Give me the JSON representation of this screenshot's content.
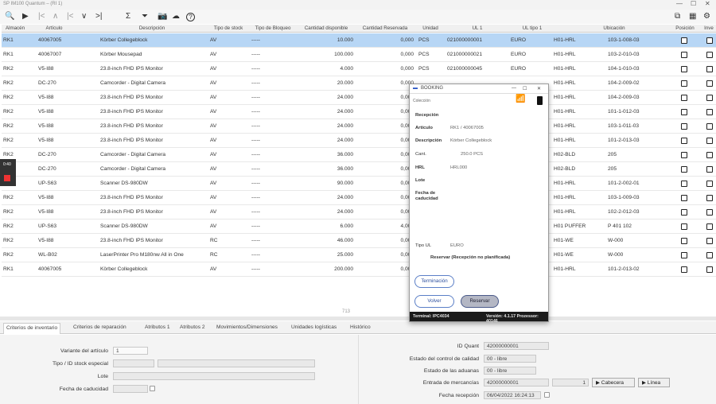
{
  "window": {
    "title": "SP IM100 Quantum – (RI 1)"
  },
  "toolbar": {
    "search": "🔍",
    "play": "▶",
    "first": "|<",
    "up": "∧",
    "prev": "|<",
    "down": "∨",
    "last": ">|",
    "sum": "Σ",
    "filter": "⏷",
    "camera": "📷",
    "cloud": "☁",
    "help": "?"
  },
  "grid": {
    "columns": [
      "Almacén",
      "Artículo",
      "Descripción",
      "Tipo de stock",
      "Tipo de Bloqueo",
      "Cantidad disponible",
      "Cantidad Reservada",
      "Unidad",
      "UL 1",
      "UL tipo 1",
      "Ubicación",
      "Posición",
      "Inve"
    ],
    "rows": [
      {
        "alm": "RK1",
        "art": "40067005",
        "desc": "Körber Collegeblock",
        "tipo": "AV",
        "bloq": "-----",
        "disp": "10.000",
        "res": "0,000",
        "uni": "PCS",
        "ul": "021000000001",
        "ult": "EURO",
        "ubic": "H01-HRL",
        "pos": "103-1-008-03"
      },
      {
        "alm": "RK1",
        "art": "40067007",
        "desc": "Körber Mousepad",
        "tipo": "AV",
        "bloq": "-----",
        "disp": "100.000",
        "res": "0,000",
        "uni": "PCS",
        "ul": "021000000021",
        "ult": "EURO",
        "ubic": "H01-HRL",
        "pos": "103-2-010-03"
      },
      {
        "alm": "RK2",
        "art": "V5-I88",
        "desc": "23.8-inch FHD IPS Monitor",
        "tipo": "AV",
        "bloq": "-----",
        "disp": "4.000",
        "res": "0,000",
        "uni": "PCS",
        "ul": "021000000045",
        "ult": "EURO",
        "ubic": "H01-HRL",
        "pos": "104-1-010-03"
      },
      {
        "alm": "RK2",
        "art": "DC-270",
        "desc": "Camcorder - Digital Camera",
        "tipo": "AV",
        "bloq": "-----",
        "disp": "20.000",
        "res": "0,000",
        "uni": "",
        "ul": "",
        "ult": "",
        "ubic": "H01-HRL",
        "pos": "104-2-009-02"
      },
      {
        "alm": "RK2",
        "art": "V5-I88",
        "desc": "23.8-inch FHD IPS Monitor",
        "tipo": "AV",
        "bloq": "-----",
        "disp": "24.000",
        "res": "0,000",
        "uni": "",
        "ul": "",
        "ult": "",
        "ubic": "H01-HRL",
        "pos": "104-2-009-03"
      },
      {
        "alm": "RK2",
        "art": "V5-I88",
        "desc": "23.8-inch FHD IPS Monitor",
        "tipo": "AV",
        "bloq": "-----",
        "disp": "24.000",
        "res": "0,000",
        "uni": "",
        "ul": "",
        "ult": "",
        "ubic": "H01-HRL",
        "pos": "101-1-012-03"
      },
      {
        "alm": "RK2",
        "art": "V5-I88",
        "desc": "23.8-inch FHD IPS Monitor",
        "tipo": "AV",
        "bloq": "-----",
        "disp": "24.000",
        "res": "0,000",
        "uni": "",
        "ul": "",
        "ult": "",
        "ubic": "H01-HRL",
        "pos": "103-1-011-03"
      },
      {
        "alm": "RK2",
        "art": "V5-I88",
        "desc": "23.8-inch FHD IPS Monitor",
        "tipo": "AV",
        "bloq": "-----",
        "disp": "24.000",
        "res": "0,000",
        "uni": "",
        "ul": "",
        "ult": "",
        "ubic": "H01-HRL",
        "pos": "101-2-013-03"
      },
      {
        "alm": "RK2",
        "art": "DC-270",
        "desc": "Camcorder - Digital Camera",
        "tipo": "AV",
        "bloq": "-----",
        "disp": "36.000",
        "res": "0,000",
        "uni": "",
        "ul": "",
        "ult": "",
        "ubic": "H02-BLD",
        "pos": "205"
      },
      {
        "alm": "RK2",
        "art": "DC-270",
        "desc": "Camcorder - Digital Camera",
        "tipo": "AV",
        "bloq": "-----",
        "disp": "36.000",
        "res": "0,000",
        "uni": "",
        "ul": "",
        "ult": "",
        "ubic": "H02-BLD",
        "pos": "205"
      },
      {
        "alm": "RK2",
        "art": "UP-S63",
        "desc": "Scanner DS-980DW",
        "tipo": "AV",
        "bloq": "-----",
        "disp": "90.000",
        "res": "0,000",
        "uni": "",
        "ul": "",
        "ult": "",
        "ubic": "H01-HRL",
        "pos": "101-2-002-01"
      },
      {
        "alm": "RK2",
        "art": "V5-I88",
        "desc": "23.8-inch FHD IPS Monitor",
        "tipo": "AV",
        "bloq": "-----",
        "disp": "24.000",
        "res": "0,000",
        "uni": "",
        "ul": "",
        "ult": "",
        "ubic": "H01-HRL",
        "pos": "103-1-009-03"
      },
      {
        "alm": "RK2",
        "art": "V5-I88",
        "desc": "23.8-inch FHD IPS Monitor",
        "tipo": "AV",
        "bloq": "-----",
        "disp": "24.000",
        "res": "0,000",
        "uni": "",
        "ul": "",
        "ult": "",
        "ubic": "H01-HRL",
        "pos": "102-2-012-03"
      },
      {
        "alm": "RK2",
        "art": "UP-S63",
        "desc": "Scanner DS-980DW",
        "tipo": "AV",
        "bloq": "-----",
        "disp": "6.000",
        "res": "4,000",
        "uni": "",
        "ul": "",
        "ult": "",
        "ubic": "H01 PUFFER",
        "pos": "P 401 102"
      },
      {
        "alm": "RK2",
        "art": "V5-I88",
        "desc": "23.8-inch FHD IPS Monitor",
        "tipo": "RC",
        "bloq": "-----",
        "disp": "46.000",
        "res": "0,000",
        "uni": "",
        "ul": "",
        "ult": "",
        "ubic": "H01-WE",
        "pos": "W-000"
      },
      {
        "alm": "RK2",
        "art": "WL-B02",
        "desc": "LaserPrinter Pro M180nw All in One",
        "tipo": "RC",
        "bloq": "-----",
        "disp": "25.000",
        "res": "0,000",
        "uni": "",
        "ul": "",
        "ult": "",
        "ubic": "H01-WE",
        "pos": "W-000"
      },
      {
        "alm": "RK1",
        "art": "40067005",
        "desc": "Körber Collegeblock",
        "tipo": "AV",
        "bloq": "-----",
        "disp": "200.000",
        "res": "0,000",
        "uni": "",
        "ul": "",
        "ult": "",
        "ubic": "H01-HRL",
        "pos": "101-2-013-02"
      }
    ],
    "count": "713"
  },
  "tabs": [
    "Criterios de inventario",
    "Criterios de reparación",
    "Atributos 1",
    "Atributos 2",
    "Movimientos/Dimensiones",
    "Unidades logísticas",
    "Histórico"
  ],
  "form": {
    "variante_label": "Variante del artículo",
    "variante_value": "1",
    "tipo_label": "Tipo / ID stock especial",
    "lote_label": "Lote",
    "fecha_cad_label": "Fecha de caducidad",
    "idquant_label": "ID Quant",
    "idquant_value": "42000000001",
    "estado_cc_label": "Estado del control de calidad",
    "estado_cc_value": "00 - libre",
    "estado_ad_label": "Estado de las aduanas",
    "estado_ad_value": "00 - libre",
    "entrada_label": "Entrada de mercancías",
    "entrada_value": "42000000001",
    "entrada_pos": "1",
    "cabecera_btn": "▶ Cabecera",
    "linea_btn": "▶ Línea",
    "fecha_rec_label": "Fecha recepción",
    "fecha_rec_value": "06/04/2022 16:24:13"
  },
  "modal": {
    "title": "BOOKING",
    "subtitle": "Colección",
    "heading": "Recepción",
    "articulo_label": "Artículo",
    "articulo_value": "RK1 / 40067005",
    "desc_label": "Descripción",
    "desc_value": "Körber Collegeblock",
    "cant_label": "Cant.",
    "cant_value": "250.0 PCS",
    "hrl_label": "HRL",
    "hrl_value": "HRL000",
    "lote_label": "Lote",
    "fecha_label": "Fecha de caducidad",
    "tipo_label": "Tipo UL",
    "tipo_value": "EURO",
    "reserve_text": "Reservar (Recepción no planificada)",
    "btn_terminar": "Terminación",
    "btn_volver": "Volver",
    "btn_reservar": "Reservar",
    "status_left": "Terminal: IPC4034",
    "status_right": "Versión: 4.1.17 Prozessor: 40146"
  }
}
